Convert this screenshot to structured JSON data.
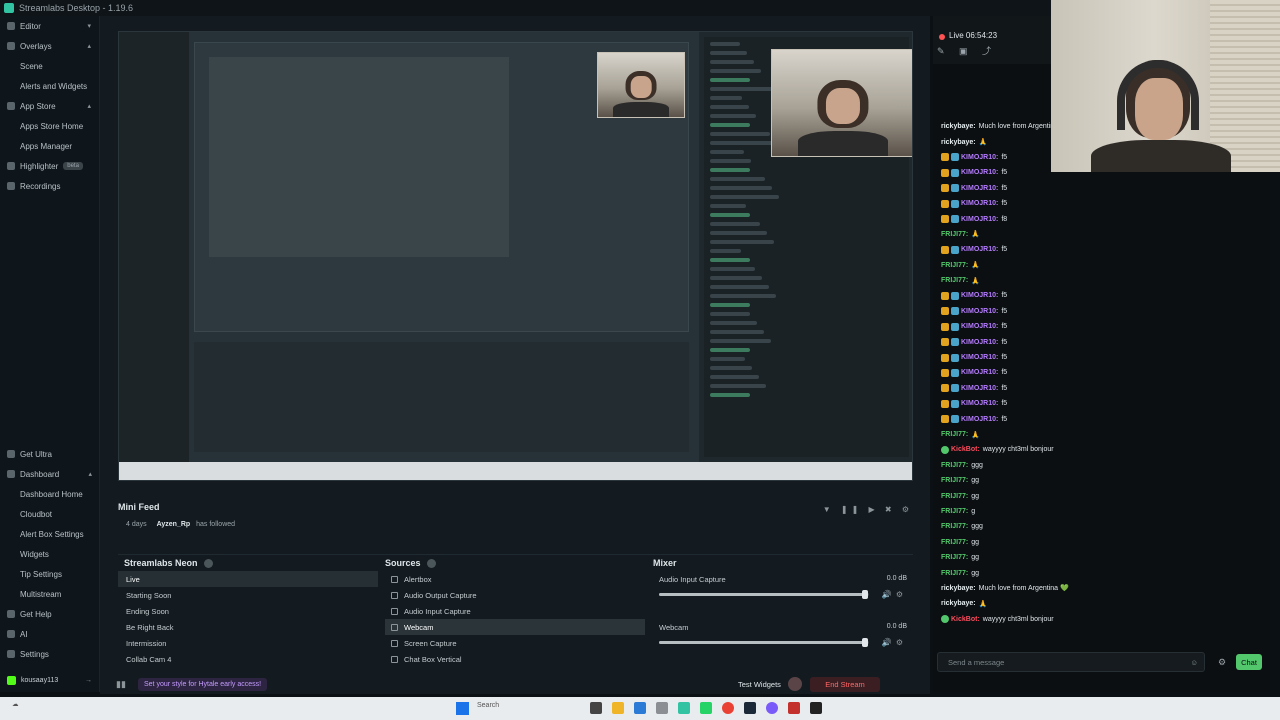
{
  "window": {
    "title": "Streamlabs Desktop - 1.19.6"
  },
  "sidebar": {
    "items": [
      {
        "label": "Editor",
        "chevron": "▾"
      },
      {
        "label": "Overlays",
        "chevron": "▴"
      },
      {
        "label": "Scene",
        "sub": true
      },
      {
        "label": "Alerts and Widgets",
        "sub": true
      },
      {
        "label": "App Store",
        "chevron": "▴"
      },
      {
        "label": "Apps Store Home",
        "sub": true
      },
      {
        "label": "Apps Manager",
        "sub": true
      },
      {
        "label": "Highlighter",
        "badge": "beta"
      },
      {
        "label": "Recordings"
      }
    ],
    "bottom_items": [
      {
        "label": "Get Ultra"
      },
      {
        "label": "Dashboard",
        "chevron": "▴"
      },
      {
        "label": "Dashboard Home",
        "sub": true
      },
      {
        "label": "Cloudbot",
        "sub": true
      },
      {
        "label": "Alert Box Settings",
        "sub": true
      },
      {
        "label": "Widgets",
        "sub": true
      },
      {
        "label": "Tip Settings",
        "sub": true
      },
      {
        "label": "Multistream",
        "sub": true
      },
      {
        "label": "Get Help"
      },
      {
        "label": "AI"
      },
      {
        "label": "Settings"
      }
    ],
    "user": "kousaay113"
  },
  "minifeed": {
    "title": "Mini Feed",
    "row_time": "4 days",
    "row_user": "Ayzen_Rp",
    "row_action": "has followed"
  },
  "scenes": {
    "title": "Streamlabs Neon",
    "items": [
      "Live",
      "Starting Soon",
      "Ending Soon",
      "Be Right Back",
      "Intermission",
      "Collab Cam 4"
    ]
  },
  "sources": {
    "title": "Sources",
    "items": [
      "Alertbox",
      "Audio Output Capture",
      "Audio Input Capture",
      "Webcam",
      "Screen Capture",
      "Chat Box Vertical"
    ]
  },
  "mixer": {
    "title": "Mixer",
    "items": [
      {
        "name": "Audio Input Capture",
        "db": "0.0 dB",
        "level": 0.98
      },
      {
        "name": "Webcam",
        "db": "0.0 dB",
        "level": 0.98
      }
    ]
  },
  "footer": {
    "promo": "Set your style for Hytale early access!",
    "test_widgets": "Test Widgets",
    "end_stream": "End Stream"
  },
  "chat": {
    "live_time": "Live 06:54:23",
    "placeholder": "Send a message",
    "send_label": "Chat",
    "messages": [
      {
        "user": "rickybaye:",
        "text": "Much love from Argentina",
        "color": "#e6edf0",
        "badge": ""
      },
      {
        "user": "rickybaye:",
        "text": "🙏",
        "color": "#e6edf0",
        "badge": ""
      },
      {
        "user": "KIMOJR10:",
        "text": "f5",
        "color": "#b57bff",
        "badge": "sub"
      },
      {
        "user": "KIMOJR10:",
        "text": "f5",
        "color": "#b57bff",
        "badge": "sub"
      },
      {
        "user": "KIMOJR10:",
        "text": "f5",
        "color": "#b57bff",
        "badge": "sub"
      },
      {
        "user": "KIMOJR10:",
        "text": "f5",
        "color": "#b57bff",
        "badge": "sub"
      },
      {
        "user": "KIMOJR10:",
        "text": "f8",
        "color": "#b57bff",
        "badge": "sub"
      },
      {
        "user": "FRIJI77:",
        "text": "🙏",
        "color": "#53c76b",
        "badge": ""
      },
      {
        "user": "KIMOJR10:",
        "text": "f5",
        "color": "#b57bff",
        "badge": "sub"
      },
      {
        "user": "FRIJI77:",
        "text": "🙏",
        "color": "#53c76b",
        "badge": ""
      },
      {
        "user": "FRIJI77:",
        "text": "🙏",
        "color": "#53c76b",
        "badge": ""
      },
      {
        "user": "KIMOJR10:",
        "text": "f5",
        "color": "#b57bff",
        "badge": "sub"
      },
      {
        "user": "KIMOJR10:",
        "text": "f5",
        "color": "#b57bff",
        "badge": "sub"
      },
      {
        "user": "KIMOJR10:",
        "text": "f5",
        "color": "#b57bff",
        "badge": "sub"
      },
      {
        "user": "KIMOJR10:",
        "text": "f5",
        "color": "#b57bff",
        "badge": "sub"
      },
      {
        "user": "KIMOJR10:",
        "text": "f5",
        "color": "#b57bff",
        "badge": "sub"
      },
      {
        "user": "KIMOJR10:",
        "text": "f5",
        "color": "#b57bff",
        "badge": "sub"
      },
      {
        "user": "KIMOJR10:",
        "text": "f5",
        "color": "#b57bff",
        "badge": "sub"
      },
      {
        "user": "KIMOJR10:",
        "text": "f5",
        "color": "#b57bff",
        "badge": "sub"
      },
      {
        "user": "KIMOJR10:",
        "text": "f5",
        "color": "#b57bff",
        "badge": "sub"
      },
      {
        "user": "FRIJI77:",
        "text": "🙏",
        "color": "#53c76b",
        "badge": ""
      },
      {
        "user": "KickBot:",
        "text": "wayyyy cht3ml bonjour",
        "color": "#ff4b5c",
        "badge": "bot"
      },
      {
        "user": "FRIJI77:",
        "text": "ggg",
        "color": "#53c76b",
        "badge": ""
      },
      {
        "user": "FRIJI77:",
        "text": "gg",
        "color": "#53c76b",
        "badge": ""
      },
      {
        "user": "FRIJI77:",
        "text": "gg",
        "color": "#53c76b",
        "badge": ""
      },
      {
        "user": "FRIJI77:",
        "text": "g",
        "color": "#53c76b",
        "badge": ""
      },
      {
        "user": "FRIJI77:",
        "text": "ggg",
        "color": "#53c76b",
        "badge": ""
      },
      {
        "user": "FRIJI77:",
        "text": "gg",
        "color": "#53c76b",
        "badge": ""
      },
      {
        "user": "FRIJI77:",
        "text": "gg",
        "color": "#53c76b",
        "badge": ""
      },
      {
        "user": "FRIJI77:",
        "text": "gg",
        "color": "#53c76b",
        "badge": ""
      },
      {
        "user": "rickybaye:",
        "text": "Much love from Argentina 💚",
        "color": "#e6edf0",
        "badge": ""
      },
      {
        "user": "rickybaye:",
        "text": "🙏",
        "color": "#e6edf0",
        "badge": ""
      },
      {
        "user": "KickBot:",
        "text": "wayyyy cht3ml bonjour",
        "color": "#ff4b5c",
        "badge": "bot"
      }
    ]
  },
  "taskbar": {
    "search": "Search"
  },
  "colors": {
    "accent": "#31c3a2",
    "kick_green": "#53fc18",
    "live_red": "#ff5252"
  }
}
